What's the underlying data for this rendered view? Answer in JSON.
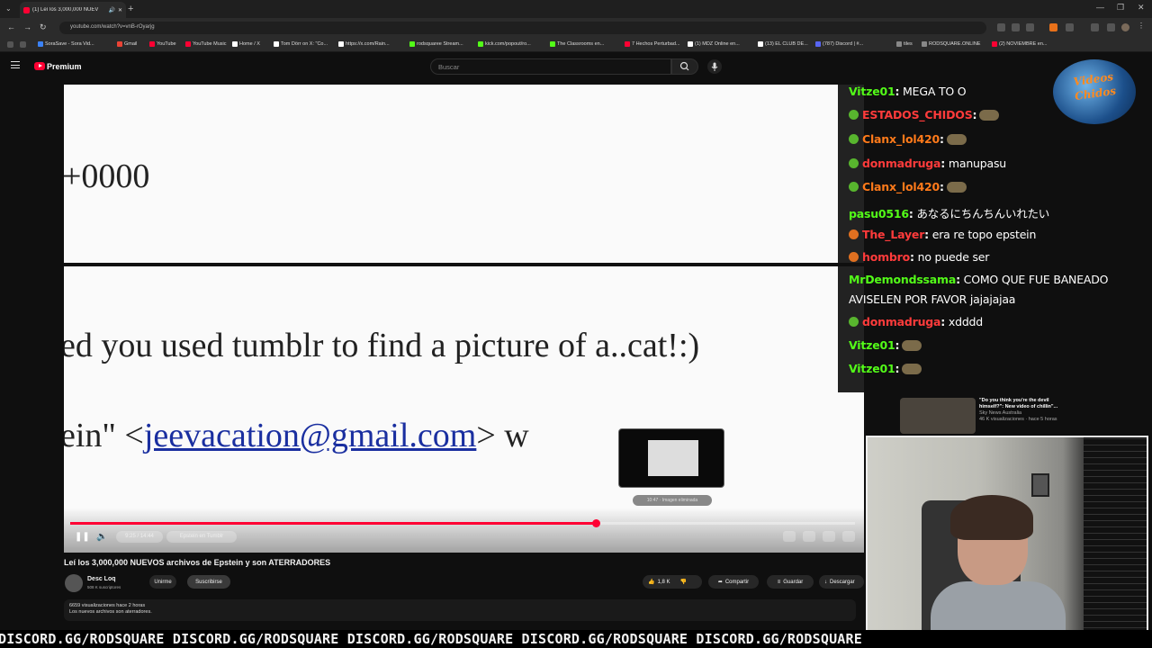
{
  "browser": {
    "tab_title": "(1) Leí los 3,000,000 NUEV",
    "url": "youtube.com/watch?v=vnB-rOyarjg",
    "bookmarks": [
      {
        "label": "SoraSave - Sora Vid...",
        "color": "#3b82f6"
      },
      {
        "label": "Gmail",
        "color": "#ea4335"
      },
      {
        "label": "YouTube",
        "color": "#ff0033"
      },
      {
        "label": "YouTube Music",
        "color": "#ff0033"
      },
      {
        "label": "Home / X",
        "color": "#ffffff"
      },
      {
        "label": "Tom Dörr on X: \"Co...",
        "color": "#ffffff"
      },
      {
        "label": "https://x.com/Rain...",
        "color": "#ffffff"
      },
      {
        "label": "rodsquaree Stream...",
        "color": "#53fc18"
      },
      {
        "label": "kick.com/popout/ro...",
        "color": "#53fc18"
      },
      {
        "label": "The Classrooms en...",
        "color": "#53fc18"
      },
      {
        "label": "7 Hechos Perturbad...",
        "color": "#ff0033"
      },
      {
        "label": "(1) MDZ Online en...",
        "color": "#ffffff"
      },
      {
        "label": "(13) EL CLUB DE...",
        "color": "#ffffff"
      },
      {
        "label": "(787) Discord | #...",
        "color": "#5865f2"
      },
      {
        "label": "tiles",
        "color": "#888888"
      },
      {
        "label": "RODSQUARE.ONLINE",
        "color": "#888888"
      },
      {
        "label": "(2) NOVIEMBRE en...",
        "color": "#ff0033"
      }
    ]
  },
  "youtube": {
    "logo_text": "Premium",
    "search_placeholder": "Buscar"
  },
  "video": {
    "doc_line1": "+0000",
    "doc_line2": "ed you used tumblr to find a picture of a..cat!:)",
    "doc_line3_prefix": "ein\" <",
    "doc_line3_link": "jeevacation@gmail.com",
    "doc_line3_suffix": "> w",
    "progress_played": 0.67,
    "progress_hover": 0.77,
    "time": "9:25 / 14:44",
    "chapter": "Epstein en Tumblr",
    "preview_label": "10:47 · Imagen eliminada"
  },
  "chat": [
    {
      "user": "Vitze01",
      "color": "#53fc18",
      "msg": " MEGA TO O",
      "badge": ""
    },
    {
      "user": "ESTADOS_CHIDOS",
      "color": "#ff3b3b",
      "msg": "",
      "badge": "green",
      "emote": true
    },
    {
      "user": "Clanx_lol420",
      "color": "#ff7a1a",
      "msg": "",
      "badge": "green",
      "emote": true
    },
    {
      "user": "donmadruga",
      "color": "#ff3b3b",
      "msg": " manupasu",
      "badge": "green"
    },
    {
      "user": "Clanx_lol420",
      "color": "#ff7a1a",
      "msg": "",
      "badge": "green",
      "emote": true
    },
    {
      "user": "pasu0516",
      "color": "#53fc18",
      "msg": " あなるにちんちんいれたい",
      "badge": ""
    },
    {
      "user": "The_Layer",
      "color": "#ff3b3b",
      "msg": " era re topo epstein",
      "badge": "org"
    },
    {
      "user": "hombro",
      "color": "#ff3b3b",
      "msg": " no puede ser",
      "badge": "org"
    },
    {
      "user": "MrDemondssama",
      "color": "#53fc18",
      "msg": " COMO QUE FUE BANEADO",
      "badge": ""
    },
    {
      "user": "",
      "color": "#ffffff",
      "msg": "AVISELEN POR FAVOR jajajajaa",
      "badge": ""
    },
    {
      "user": "donmadruga",
      "color": "#ff3b3b",
      "msg": " xdddd",
      "badge": "green"
    },
    {
      "user": "Vitze01",
      "color": "#53fc18",
      "msg": "",
      "badge": "",
      "emote": true
    },
    {
      "user": "Vitze01",
      "color": "#53fc18",
      "msg": "",
      "badge": "",
      "emote": true
    }
  ],
  "overlay_logo": "Videos Chidos",
  "recommended": {
    "title": "\"Do you think you're the devil himself?\": New video of chillin\"...",
    "channel": "Sky News Australia",
    "meta": "46 K visualizaciones · hace 5 horas"
  },
  "video_info": {
    "title": "Leí los 3,000,000 NUEVOS archivos de Epstein y son ATERRADORES",
    "channel": "Desc Loq",
    "subscribers": "508 K suscriptores",
    "join_label": "Unirme",
    "subscribe_label": "Suscribirse",
    "likes": "1,8 K",
    "share_label": "Compartir",
    "save_label": "Guardar",
    "download_label": "Descargar",
    "views_line": "6659 visualizaciones  hace 2 horas",
    "desc_line": "Los nuevos archivos son aterradores."
  },
  "ticker": "DISCORD.GG/RODSQUARE DISCORD.GG/RODSQUARE DISCORD.GG/RODSQUARE DISCORD.GG/RODSQUARE DISCORD.GG/RODSQUARE"
}
